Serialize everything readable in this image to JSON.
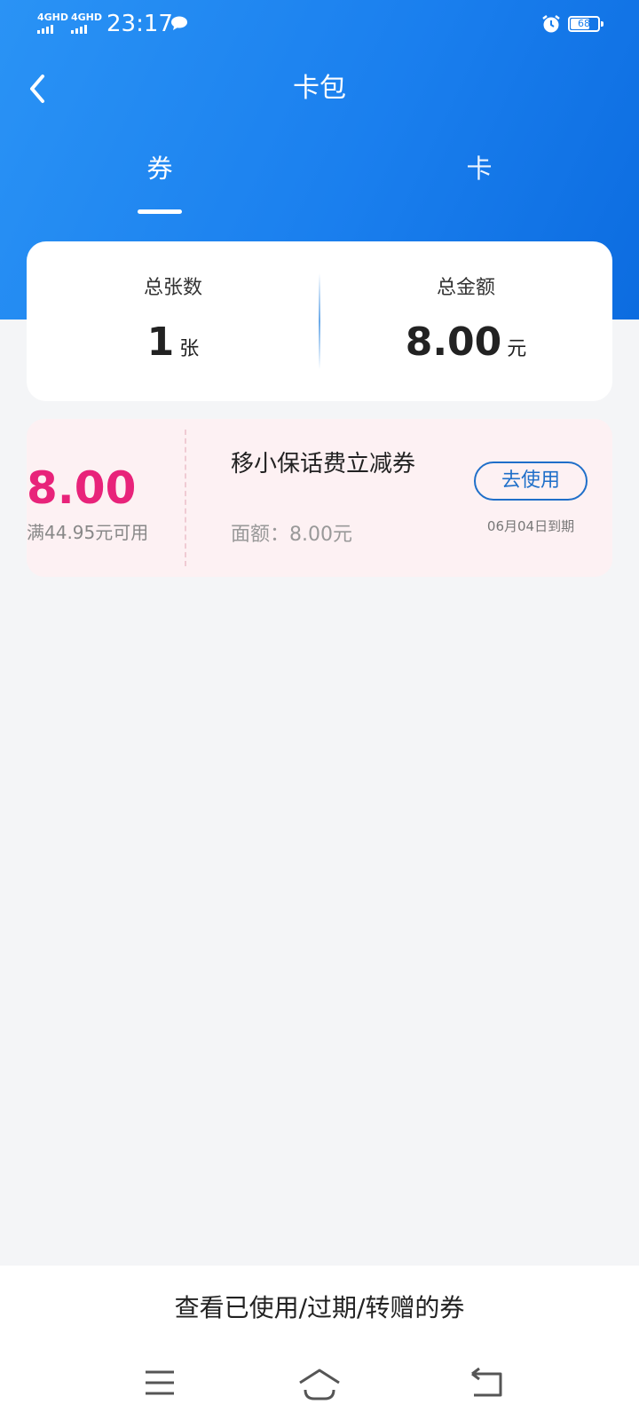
{
  "status_bar": {
    "network1": "4GHD",
    "network2": "4GHD",
    "time": "23:17",
    "battery": "68"
  },
  "header": {
    "title": "卡包"
  },
  "tabs": [
    {
      "label": "券",
      "active": true
    },
    {
      "label": "卡",
      "active": false
    }
  ],
  "summary": {
    "count_label": "总张数",
    "count_value": "1",
    "count_unit": "张",
    "amount_label": "总金额",
    "amount_value": "8.00",
    "amount_unit": "元"
  },
  "coupons": [
    {
      "amount": "8.00",
      "condition": "满44.95元可用",
      "name": "移小保话费立减券",
      "face_value": "面额：8.00元",
      "action_label": "去使用",
      "expiry": "06月04日到期"
    }
  ],
  "footer": {
    "history_link": "查看已使用/过期/转赠的券"
  },
  "colors": {
    "header_blue": "#1a7fee",
    "accent_pink": "#e8237a",
    "button_blue": "#1f6fc9",
    "coupon_bg": "#fdf1f3"
  },
  "icons": [
    "back-arrow-icon",
    "message-icon",
    "alarm-icon",
    "battery-icon",
    "menu-icon",
    "home-icon",
    "nav-back-icon"
  ]
}
